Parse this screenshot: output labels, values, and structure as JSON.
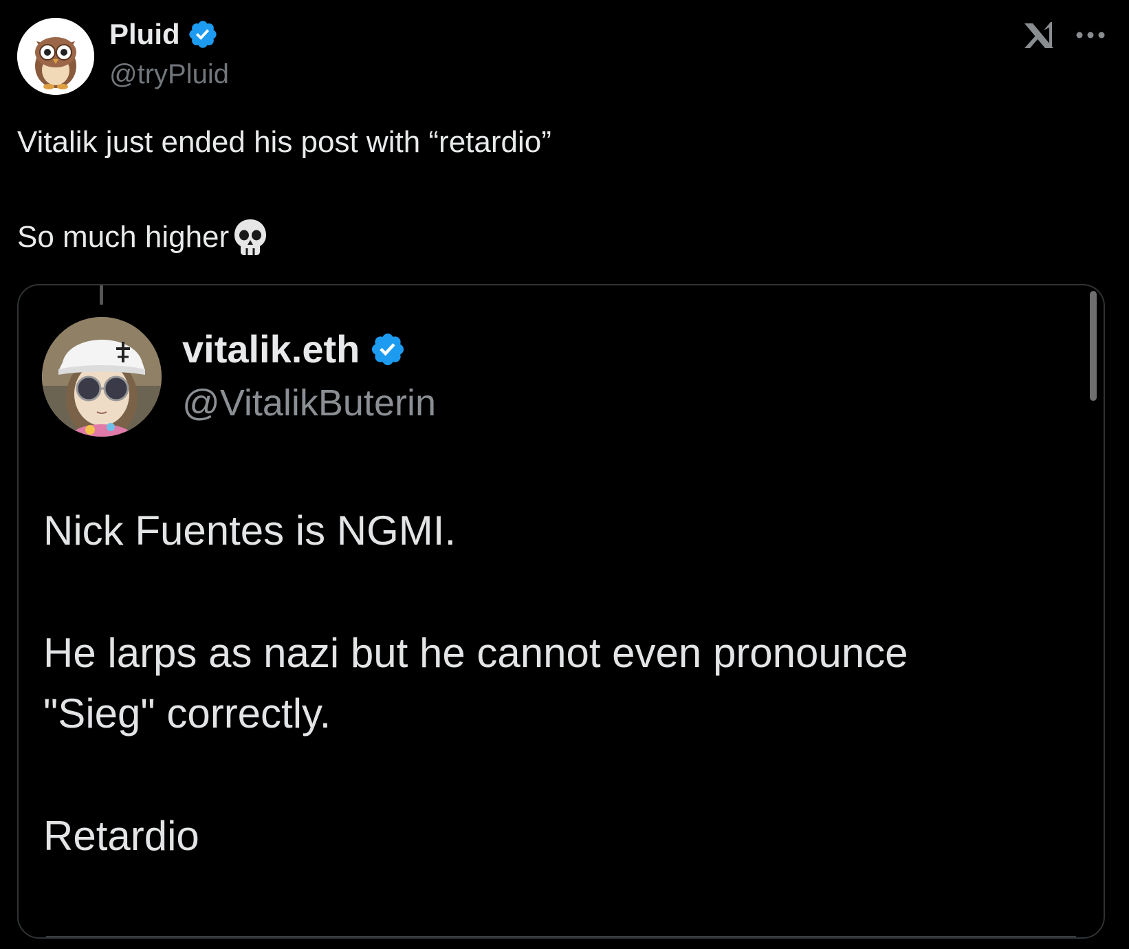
{
  "author": {
    "name": "Pluid",
    "handle": "@tryPluid",
    "verified": true
  },
  "tweet": {
    "line1": "Vitalik just ended his post with “retardio”",
    "line2": "So much higher",
    "emoji": "skull-icon"
  },
  "quoted": {
    "name": "vitalik.eth",
    "handle": "@VitalikButerin",
    "verified": true,
    "text_line1": "Nick Fuentes is NGMI.",
    "text_line2": "He larps as nazi but he cannot even pronounce",
    "text_line3": "\"Sieg\" correctly.",
    "text_line4": "Retardio"
  },
  "colors": {
    "background": "#000000",
    "text": "#e7e9ea",
    "secondary": "#71767b",
    "verified_blue": "#1d9bf0",
    "border": "#2f3336"
  }
}
